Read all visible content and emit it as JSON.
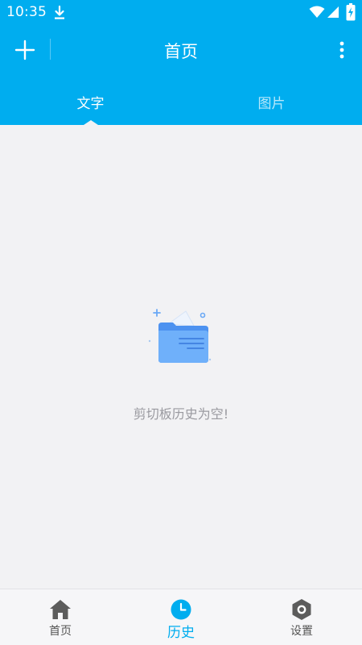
{
  "status_bar": {
    "time": "10:35",
    "icons": [
      "download-icon",
      "wifi-icon",
      "signal-icon",
      "battery-charging-icon"
    ]
  },
  "toolbar": {
    "title": "首页",
    "add_icon": "plus-icon",
    "more_icon": "more-vertical-icon"
  },
  "tabs": [
    {
      "label": "文字",
      "active": true
    },
    {
      "label": "图片",
      "active": false
    }
  ],
  "empty_state": {
    "icon": "empty-clipboard-folder-icon",
    "message": "剪切板历史为空!"
  },
  "bottom_nav": [
    {
      "label": "首页",
      "icon": "home-icon",
      "active": false
    },
    {
      "label": "历史",
      "icon": "clock-icon",
      "active": true
    },
    {
      "label": "设置",
      "icon": "settings-hexagon-icon",
      "active": false
    }
  ],
  "colors": {
    "primary": "#00adef",
    "background": "#f2f2f4",
    "inactive_icon": "#5c5c5c",
    "empty_text": "#9a9aa0"
  }
}
